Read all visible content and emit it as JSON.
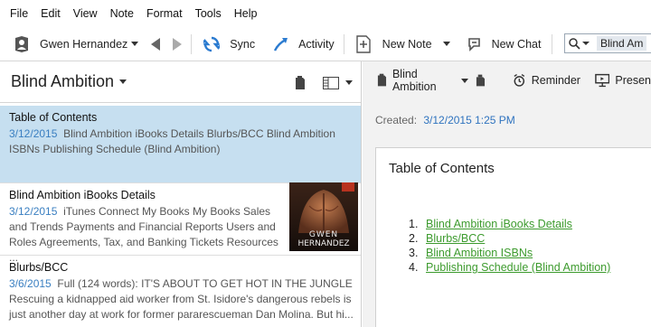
{
  "menu": [
    "File",
    "Edit",
    "View",
    "Note",
    "Format",
    "Tools",
    "Help"
  ],
  "toolbar": {
    "user": "Gwen Hernandez",
    "sync": "Sync",
    "activity": "Activity",
    "new_note": "New Note",
    "new_chat": "New Chat",
    "search_query": "Blind Am"
  },
  "notebook": {
    "title": "Blind Ambition"
  },
  "notes": [
    {
      "title": "Table of Contents",
      "date": "3/12/2015",
      "snippet": "Blind Ambition iBooks Details Blurbs/BCC Blind Ambition ISBNs Publishing Schedule (Blind Ambition)"
    },
    {
      "title": "Blind Ambition iBooks Details",
      "date": "3/12/2015",
      "snippet": "iTunes Connect My Books My Books Sales and Trends Payments and Financial Reports Users and Roles Agreements, Tax, and Banking Tickets Resources ..."
    },
    {
      "title": "Blurbs/BCC",
      "date": "3/6/2015",
      "snippet": "Full (124 words): IT'S ABOUT TO GET HOT IN THE JUNGLE Rescuing a kidnapped aid worker from St. Isidore's dangerous rebels is just another day at work for former pararescueman Dan Molina. But hi..."
    }
  ],
  "cover": {
    "author_line1": "GWEN",
    "author_line2": "HERNANDEZ"
  },
  "editor": {
    "notebook": "Blind Ambition",
    "reminder": "Reminder",
    "present": "Presen",
    "created_label": "Created:",
    "created_value": "3/12/2015 1:25 PM",
    "title": "Table of Contents",
    "toc": [
      {
        "num": "1.",
        "label": "Blind Ambition iBooks Details"
      },
      {
        "num": "2.",
        "label": "Blurbs/BCC"
      },
      {
        "num": "3.",
        "label": "Blind Ambition ISBNs"
      },
      {
        "num": "4.",
        "label": "Publishing Schedule (Blind Ambition)"
      }
    ]
  },
  "colors": {
    "accent": "#2f73bf",
    "link": "#3d9b2e",
    "selected": "#c6dff0"
  }
}
